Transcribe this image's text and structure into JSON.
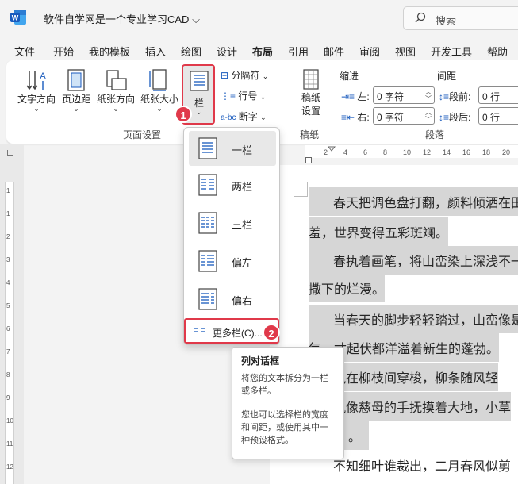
{
  "title_bar": {
    "document_title": "软件自学网是一个专业学习CAD",
    "search_placeholder": "搜索"
  },
  "menu": [
    {
      "label": "文件"
    },
    {
      "label": "开始"
    },
    {
      "label": "我的模板"
    },
    {
      "label": "插入"
    },
    {
      "label": "绘图"
    },
    {
      "label": "设计"
    },
    {
      "label": "布局",
      "active": true
    },
    {
      "label": "引用"
    },
    {
      "label": "邮件"
    },
    {
      "label": "审阅"
    },
    {
      "label": "视图"
    },
    {
      "label": "开发工具"
    },
    {
      "label": "帮助"
    }
  ],
  "ribbon": {
    "text_direction": "文字方向",
    "margins": "页边距",
    "orientation": "纸张方向",
    "size": "纸张大小",
    "columns": "栏",
    "breaks": "分隔符",
    "line_numbers": "行号",
    "hyphenation": "断字",
    "page_setup_group": "页面设置",
    "draft_paper": "稿纸设置",
    "draft_line1": "稿纸",
    "draft_line2": "设置",
    "draft_group": "稿纸",
    "indent_label": "缩进",
    "spacing_label": "间距",
    "indent_left_label": "左:",
    "indent_left_value": "0 字符",
    "indent_right_label": "右:",
    "indent_right_value": "0 字符",
    "space_before_label": "段前:",
    "space_before_value": "0 行",
    "space_after_label": "段后:",
    "space_after_value": "0 行",
    "paragraph_group": "段落"
  },
  "columns_menu": {
    "items": [
      "一栏",
      "两栏",
      "三栏",
      "偏左",
      "偏右"
    ],
    "more": "更多栏(C)..."
  },
  "badges": {
    "one": "1",
    "two": "2"
  },
  "tooltip": {
    "title": "列对话框",
    "line1": "将您的文本拆分为一栏或多栏。",
    "line2": "您也可以选择栏的宽度和间距，或使用其中一种预设格式。"
  },
  "ruler_numbers": [
    "2",
    "4",
    "6",
    "8",
    "10",
    "12",
    "14",
    "16",
    "18",
    "20"
  ],
  "vruler_numbers": [
    "1",
    "1",
    "2",
    "3",
    "4",
    "5",
    "6",
    "7",
    "8",
    "9",
    "10",
    "11",
    "12"
  ],
  "document": {
    "l1": "春天把调色盘打翻，颜料倾洒在田",
    "l2": "羞，世界变得五彩斑斓。",
    "l3": "春执着画笔，将山峦染上深浅不一",
    "l4": "撒下的烂漫。",
    "l5": "当春天的脚步轻轻踏过，山峦像是",
    "l6": "每一寸起伏都洋溢着新生的蓬勃。",
    "l7": "风在柳枝间穿梭，柳条随风轻",
    "l8": "风像慈母的手抚摸着大地，小草",
    "l9": "。",
    "l10": "不知细叶谁裁出，二月春风似剪"
  }
}
